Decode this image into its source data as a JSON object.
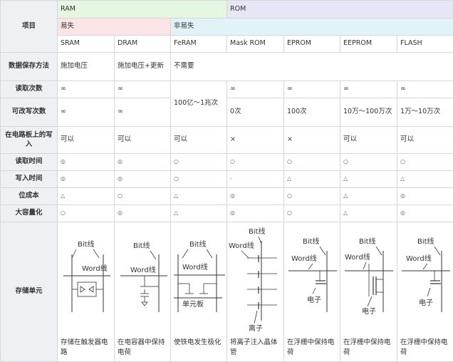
{
  "header": {
    "item_label": "项目",
    "ram": "RAM",
    "rom": "ROM",
    "volatile": "易失",
    "nonvolatile": "非易失"
  },
  "memories": [
    "SRAM",
    "DRAM",
    "FeRAM",
    "Mask ROM",
    "EPROM",
    "EEPROM",
    "FLASH"
  ],
  "rows": {
    "retention": {
      "label": "数据保存方法",
      "sram": "施加电压",
      "dram": "施加电压+更新",
      "rest": "不需要"
    },
    "read_count": {
      "label": "读取次数",
      "sram": "∞",
      "dram": "∞",
      "feram": "100亿～1兆次",
      "maskrom": "∞",
      "eprom": "∞",
      "eeprom": "∞",
      "flash": "∞"
    },
    "write_count": {
      "label": "可改写次数",
      "sram": "∞",
      "dram": "∞",
      "maskrom": "0次",
      "eprom": "100次",
      "eeprom": "10万～100万次",
      "flash": "1万～10万次"
    },
    "onboard_write": {
      "label": "在电路板上的写入",
      "sram": "可以",
      "dram": "可以",
      "feram": "可以",
      "maskrom": "×",
      "eprom": "×",
      "eeprom": "可以",
      "flash": "可以"
    },
    "read_time": {
      "label": "读取时间",
      "sram": "◎",
      "dram": "◎",
      "feram": "○",
      "maskrom": "○",
      "eprom": "○",
      "eeprom": "○",
      "flash": "○"
    },
    "write_time": {
      "label": "写入时间",
      "sram": "◎",
      "dram": "◎",
      "feram": "○",
      "maskrom": "-",
      "eprom": "△",
      "eeprom": "△",
      "flash": "△"
    },
    "bit_cost": {
      "label": "位成本",
      "sram": "△",
      "dram": "○",
      "feram": "△",
      "maskrom": "◎",
      "eprom": "○",
      "eeprom": "△",
      "flash": "◎"
    },
    "capacity": {
      "label": "大容量化",
      "sram": "○",
      "dram": "◎",
      "feram": "△",
      "maskrom": "◎",
      "eprom": "○",
      "eeprom": "△",
      "flash": "◎"
    },
    "cell": {
      "label": "存储单元",
      "bitline": "Bit线",
      "wordline": "Word线",
      "unit_plate": "单元板",
      "ion": "离子",
      "electron": "电子",
      "sram": "存储在触发器电路",
      "dram": "在电容器中保持电荷",
      "feram": "使铁电发生极化",
      "maskrom": "将离子注入晶体管",
      "eprom": "在浮栅中保持电荷",
      "eeprom": "在浮栅中保持电荷",
      "flash": "在浮栅中保持电荷"
    }
  }
}
